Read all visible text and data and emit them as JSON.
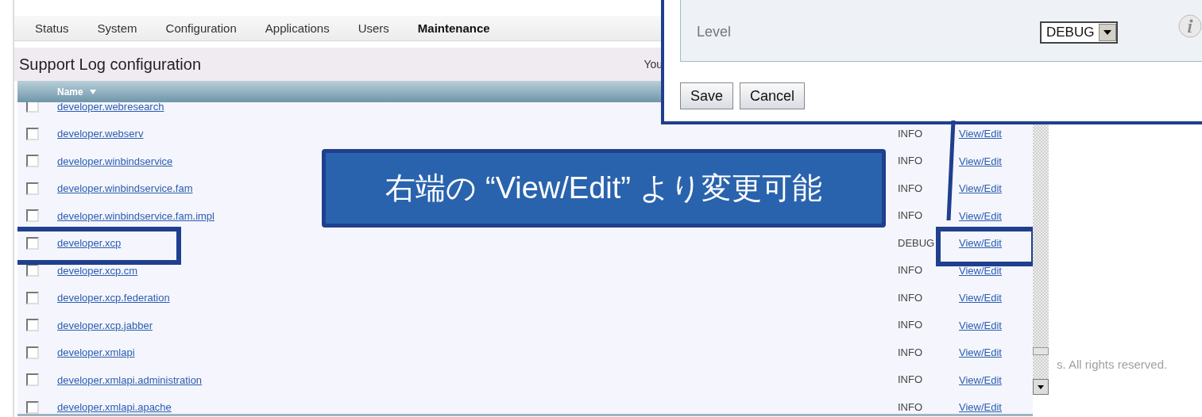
{
  "tabs": [
    {
      "label": "Status",
      "selected": false
    },
    {
      "label": "System",
      "selected": false
    },
    {
      "label": "Configuration",
      "selected": false
    },
    {
      "label": "Applications",
      "selected": false
    },
    {
      "label": "Users",
      "selected": false
    },
    {
      "label": "Maintenance",
      "selected": true
    }
  ],
  "page_title": "Support Log configuration",
  "user_text": "You",
  "table": {
    "columns": [
      {
        "label": "Name",
        "sorted": true
      }
    ],
    "rows": [
      {
        "name": "developer.webresearch",
        "checked": false,
        "highlighted": false
      },
      {
        "name": "developer.webserv",
        "checked": false,
        "highlighted": false,
        "level": "INFO",
        "link": "View/Edit"
      },
      {
        "name": "developer.winbindservice",
        "checked": false,
        "highlighted": false,
        "level": "INFO",
        "link": "View/Edit"
      },
      {
        "name": "developer.winbindservice.fam",
        "checked": false,
        "highlighted": false,
        "level": "INFO",
        "link": "View/Edit"
      },
      {
        "name": "developer.winbindservice.fam.impl",
        "checked": false,
        "highlighted": false,
        "level": "INFO",
        "link": "View/Edit"
      },
      {
        "name": "developer.xcp",
        "checked": false,
        "highlighted": true,
        "level": "DEBUG",
        "link": "View/Edit"
      },
      {
        "name": "developer.xcp.cm",
        "checked": false,
        "highlighted": false,
        "level": "INFO",
        "link": "View/Edit"
      },
      {
        "name": "developer.xcp.federation",
        "checked": false,
        "highlighted": false,
        "level": "INFO",
        "link": "View/Edit"
      },
      {
        "name": "developer.xcp.jabber",
        "checked": false,
        "highlighted": false,
        "level": "INFO",
        "link": "View/Edit"
      },
      {
        "name": "developer.xmlapi",
        "checked": false,
        "highlighted": false,
        "level": "INFO",
        "link": "View/Edit"
      },
      {
        "name": "developer.xmlapi.administration",
        "checked": false,
        "highlighted": false,
        "level": "INFO",
        "link": "View/Edit"
      },
      {
        "name": "developer.xmlapi.apache",
        "checked": false,
        "highlighted": false,
        "level": "INFO",
        "link": "View/Edit"
      }
    ]
  },
  "popup": {
    "level_label": "Level",
    "level_value": "DEBUG",
    "buttons": [
      "Save",
      "Cancel"
    ]
  },
  "callout": {
    "text": "右端の “View/Edit” より変更可能"
  },
  "footer": "s. All rights reserved."
}
